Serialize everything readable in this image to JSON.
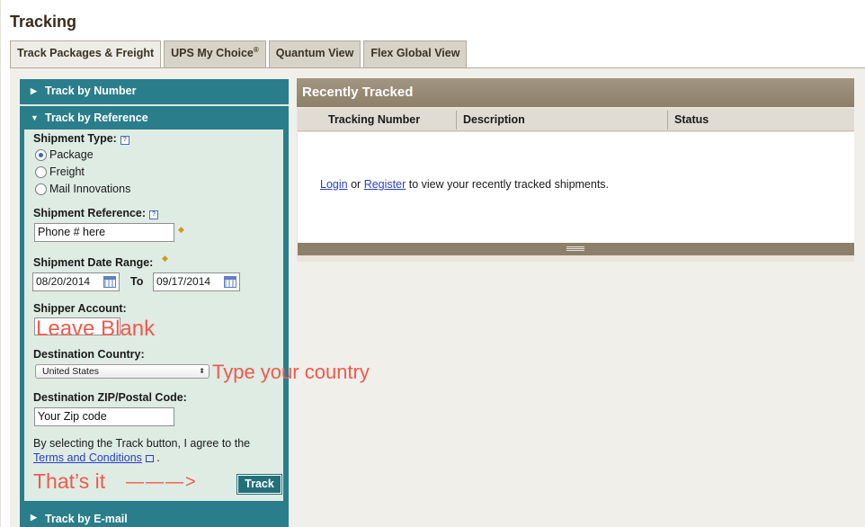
{
  "page": {
    "title": "Tracking"
  },
  "tabs": [
    {
      "label": "Track Packages & Freight",
      "active": true
    },
    {
      "label": "UPS My Choice",
      "mark": "®"
    },
    {
      "label": "Quantum View"
    },
    {
      "label": "Flex Global View"
    }
  ],
  "accordion": {
    "track_by_number": "Track by Number",
    "track_by_reference": "Track by Reference",
    "track_by_email": "Track by E-mail"
  },
  "form": {
    "shipment_type_label": "Shipment Type:",
    "shipment_types": [
      "Package",
      "Freight",
      "Mail Innovations"
    ],
    "shipment_type_selected": "Package",
    "reference_label": "Shipment Reference:",
    "reference_value": "Phone # here",
    "date_range_label": "Shipment Date Range:",
    "date_from": "08/20/2014",
    "to_label": "To",
    "date_to": "09/17/2014",
    "shipper_account_label": "Shipper Account:",
    "shipper_account_value": "",
    "destination_country_label": "Destination Country:",
    "destination_country_value": "United States",
    "zip_label": "Destination ZIP/Postal Code:",
    "zip_value": "Your Zip code",
    "agree_text": "By selecting the Track button, I agree to the",
    "terms_link": "Terms and Conditions",
    "agree_end": ".",
    "track_button": "Track"
  },
  "annotations": {
    "leave_blank": "Leave Blank",
    "type_country": "Type your country",
    "thats_it": "That’s it",
    "arrow": "———>"
  },
  "recently_tracked": {
    "title": "Recently Tracked",
    "columns": [
      "Tracking Number",
      "Description",
      "Status"
    ],
    "login_link": "Login",
    "or_text": "or",
    "register_link": "Register",
    "message": "to view your recently tracked shipments."
  },
  "colors": {
    "accordion_teal": "#2a7e8b",
    "form_bg": "#deece3",
    "annotation_red": "#ee5a4e",
    "header_taupe": "#8c806b",
    "link_blue": "#2a3ec1"
  }
}
